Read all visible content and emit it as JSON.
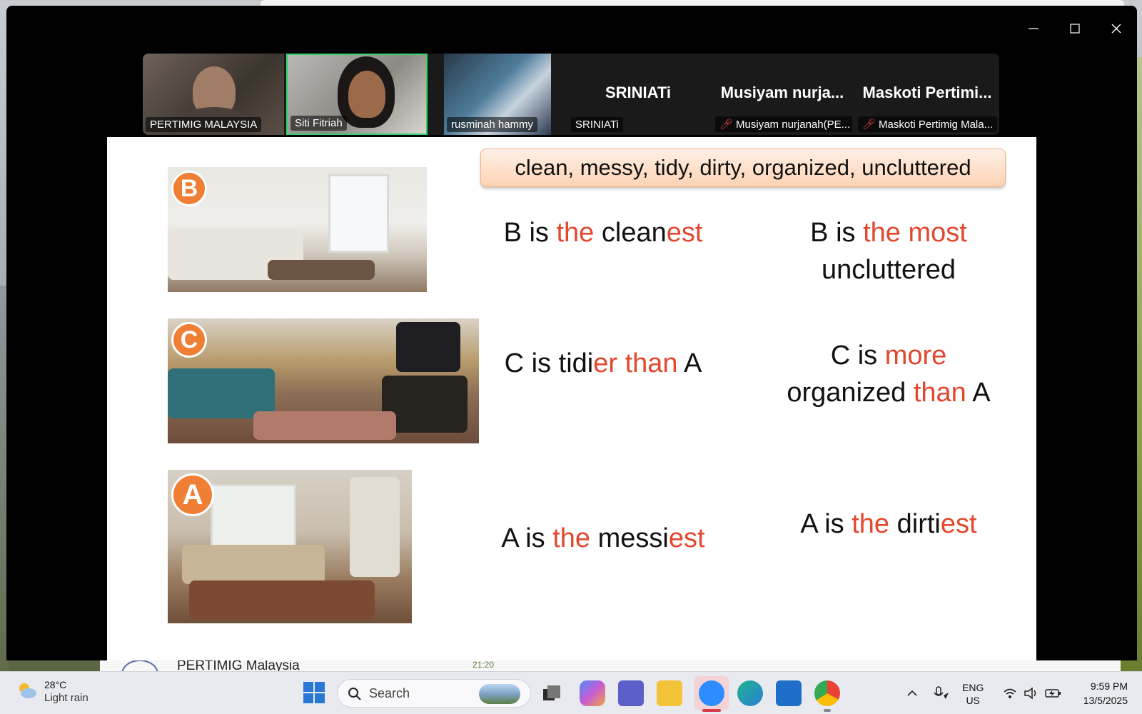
{
  "meeting": {
    "participants": [
      {
        "name": "PERTIMIG MALAYSIA",
        "kind": "video"
      },
      {
        "name": "Siti Fitriah",
        "kind": "video",
        "speaking": true
      },
      {
        "name": "rusminah hammy",
        "kind": "video"
      },
      {
        "name": "SRINIATi",
        "display": "SRINIATi",
        "kind": "name",
        "muted": false
      },
      {
        "name": "Musiyam nurjanah(PE...",
        "display": "Musiyam  nurja...",
        "kind": "name",
        "muted": true
      },
      {
        "name": "Maskoti Pertimig Mala...",
        "display": "Maskoti  Pertimi...",
        "kind": "name",
        "muted": true
      }
    ]
  },
  "slide": {
    "word_bank": "clean, messy, tidy, dirty, organized, uncluttered",
    "badges": {
      "b": "B",
      "c": "C",
      "a": "A"
    },
    "rows": {
      "b": {
        "superlative": {
          "p1": "B is ",
          "p2": "the",
          "p3": " clean",
          "p4": "est"
        },
        "most": {
          "p1": "B is ",
          "p2": "the most",
          "p3": "uncluttered"
        }
      },
      "c": {
        "comparative": {
          "p1": "C is tidi",
          "p2": "er than",
          "p3": " A"
        },
        "more": {
          "p1": "C is ",
          "p2": "more",
          "p3": "organized ",
          "p4": "than",
          "p5": " A"
        }
      },
      "a": {
        "superlative": {
          "p1": "A is ",
          "p2": "the",
          "p3": " messi",
          "p4": "est"
        },
        "dirtiest": {
          "p1": "A is ",
          "p2": "the",
          "p3": " dirti",
          "p4": "est"
        }
      }
    }
  },
  "background_chat": {
    "name": "PERTIMIG Malaysia",
    "time": "21:20"
  },
  "taskbar": {
    "weather": {
      "temp": "28°C",
      "condition": "Light rain"
    },
    "search_placeholder": "Search",
    "language": {
      "line1": "ENG",
      "line2": "US"
    },
    "clock": {
      "time": "9:59 PM",
      "date": "13/5/2025"
    }
  },
  "colors": {
    "accent_red": "#e3472d",
    "badge_orange": "#f07f36",
    "speaking_border": "#2fd46c"
  }
}
